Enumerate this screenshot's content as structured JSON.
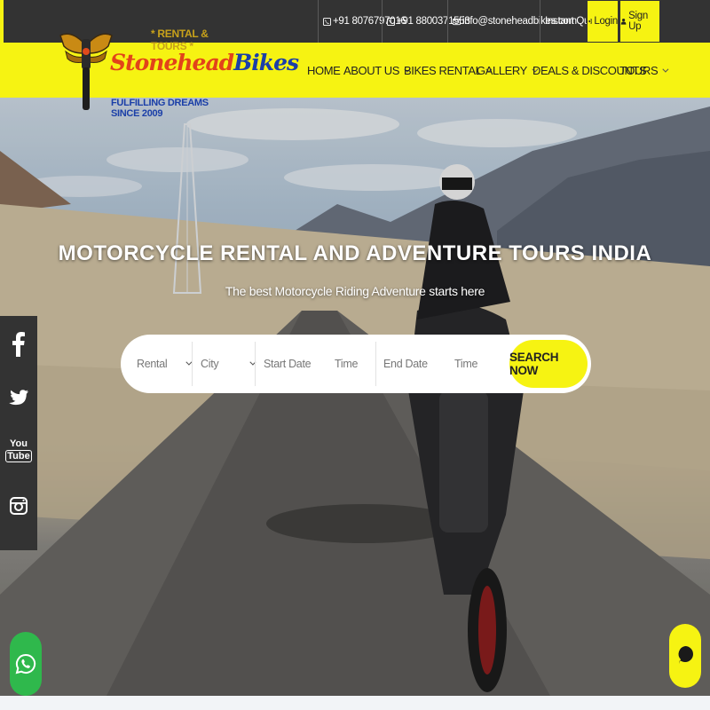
{
  "topbar": {
    "phone1": "+91 8076797016",
    "phone2": "+91 8800371553",
    "email": "info@stoneheadbikes.com",
    "instant_quote": "Instant Quote",
    "login": "Login",
    "signup": "Sign Up"
  },
  "logo": {
    "tagline": "* RENTAL & TOURS *",
    "name_part1": "Stonehead",
    "name_part2": "Bikes",
    "subtitle": "FULFILLING DREAMS SINCE 2009"
  },
  "nav": {
    "items": [
      {
        "label": "HOME"
      },
      {
        "label": "ABOUT US"
      },
      {
        "label": "BIKES RENTAL"
      },
      {
        "label": "GALLERY"
      },
      {
        "label": "DEALS & DISCOUNTS"
      },
      {
        "label": "TOURS"
      }
    ]
  },
  "hero": {
    "title": "MOTORCYCLE RENTAL AND ADVENTURE TOURS INDIA",
    "subtitle": "The best Motorcycle Riding Adventure starts here"
  },
  "search": {
    "rental": "Rental",
    "city": "City",
    "start_date": "Start Date",
    "start_time": "Time",
    "end_date": "End Date",
    "end_time": "Time",
    "button": "SEARCH NOW"
  },
  "social": [
    "facebook-icon",
    "twitter-icon",
    "youtube-icon",
    "instagram-icon"
  ],
  "youtube_text": {
    "you": "You",
    "tube": "Tube"
  },
  "colors": {
    "accent": "#f6f312",
    "topbar_bg": "#333333",
    "brand_red": "#e2431a",
    "brand_blue": "#1b3fa8",
    "whatsapp": "#2fb84c"
  }
}
